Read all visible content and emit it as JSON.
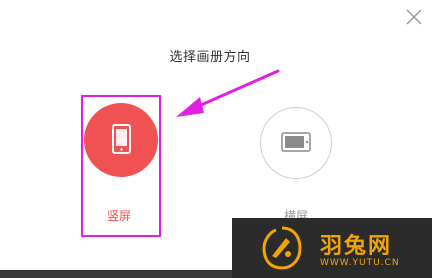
{
  "dialog": {
    "title": "选择画册方向",
    "close_icon": "close-icon"
  },
  "options": {
    "portrait": {
      "label": "竖屏",
      "icon": "phone-portrait-icon",
      "selected": true,
      "color": "#f05152"
    },
    "landscape": {
      "label": "横屏",
      "icon": "phone-landscape-icon",
      "selected": false
    }
  },
  "annotation": {
    "highlight_color": "#e21fe6",
    "arrow_icon": "pointer-arrow-icon"
  },
  "watermark": {
    "name": "羽兔网",
    "url": "WWW.YUTU.CN",
    "logo": "yutu-logo-icon",
    "color": "#f2a400"
  }
}
